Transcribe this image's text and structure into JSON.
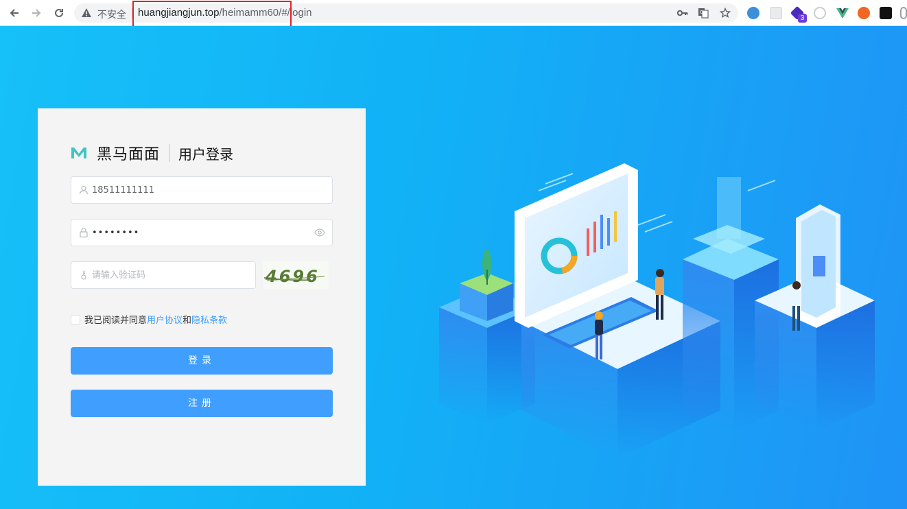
{
  "browser": {
    "insecure_label": "不安全",
    "url_host": "huangjiangjun.top",
    "url_path": "/heimamm60/#/login",
    "extension_badge": "3"
  },
  "login": {
    "brand_name": "黑马面面",
    "page_title": "用户登录",
    "phone_value": "18511111111",
    "password_value": "••••••••",
    "captcha_placeholder": "请输入验证码",
    "captcha_text": "4696",
    "agree_prefix": "我已阅读并同意",
    "user_agreement": "用户协议",
    "and_text": "和",
    "privacy_terms": "隐私条款",
    "login_button": "登录",
    "register_button": "注册"
  },
  "colors": {
    "primary": "#409eff",
    "brand_teal": "#41c4c8",
    "background": "#16c0f8",
    "highlight_box": "#e0242b"
  }
}
